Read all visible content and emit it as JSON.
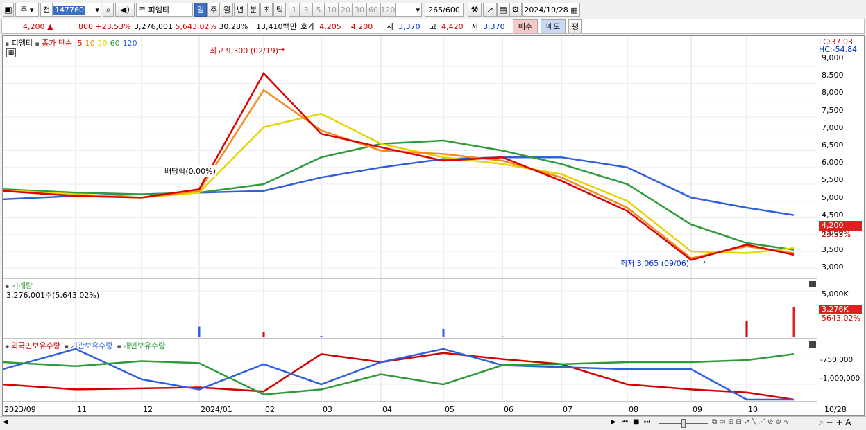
{
  "toolbar": {
    "market": "주",
    "scope": "전",
    "code": "147760",
    "prefix": "코",
    "name": "피엠티",
    "periods": [
      "일",
      "주",
      "월",
      "년",
      "분",
      "초",
      "틱"
    ],
    "active_period": "일",
    "intervals": [
      "1",
      "3",
      "5",
      "10",
      "20",
      "30",
      "60",
      "120"
    ],
    "count": "265",
    "count_total": "/600",
    "date": "2024/10/28"
  },
  "quote": {
    "price": "4,200",
    "change_arrow": "▲",
    "change": "800",
    "change_pct": "+23.53%",
    "volume": "3,276,001",
    "volume_pct": "5,643.02%",
    "turnover": "30.28%",
    "amount": "13,410백만",
    "ask_label": "호가",
    "ask": "4,205",
    "bid": "4,200",
    "open_label": "시",
    "open": "3,370",
    "high_label": "고",
    "high": "4,420",
    "low_label": "저",
    "low": "3,370",
    "buy_label": "매수",
    "sell_label": "매도",
    "eval_label": "평"
  },
  "price_panel": {
    "title": "피엠티",
    "ma_label": "종가 단순",
    "ma_periods": [
      {
        "label": "5",
        "color": "#e00000"
      },
      {
        "label": "10",
        "color": "#f28c1e"
      },
      {
        "label": "20",
        "color": "#e6d400"
      },
      {
        "label": "60",
        "color": "#2e9a3a"
      },
      {
        "label": "120",
        "color": "#2f5fdc"
      }
    ],
    "max_note": "최고 9,300 (02/19)",
    "min_note": "최저 3,065 (09/06)",
    "dividend_note": "배당락(0.00%)",
    "lc": "LC:37.03",
    "hc": "HC:-54.84",
    "price_tag": "4,200",
    "pct_tag": "23.53%",
    "y_ticks": [
      "9,000",
      "8,500",
      "8,000",
      "7,500",
      "7,000",
      "6,500",
      "6,000",
      "5,500",
      "5,000",
      "4,500",
      "4,000",
      "3,500",
      "3,000"
    ]
  },
  "volume_panel": {
    "title": "거래량",
    "subtitle": "3,276,001주(5,643.02%)",
    "y_tick": "5,000K",
    "tag": "3,276K",
    "pct_tag": "5643.02%"
  },
  "holding_panel": {
    "series": [
      {
        "name": "외국인보유수량",
        "color": "#d20000"
      },
      {
        "name": "기관보유수량",
        "color": "#2f5fdc"
      },
      {
        "name": "개인보유수량",
        "color": "#2e9a3a"
      }
    ],
    "y_ticks": [
      "-750,000",
      "-1,000,000"
    ]
  },
  "x_axis": [
    "2023/09",
    "11",
    "12",
    "2024/01",
    "02",
    "03",
    "04",
    "05",
    "06",
    "07",
    "08",
    "09",
    "10",
    "10/28"
  ],
  "chart_data": [
    {
      "type": "line",
      "title": "피엠티",
      "x": [
        "2023/09",
        "11",
        "12",
        "2024/01",
        "02",
        "03",
        "04",
        "05",
        "06",
        "07",
        "08",
        "09",
        "10",
        "10/28"
      ],
      "series": [
        {
          "name": "5",
          "values": [
            5300,
            5150,
            5100,
            5350,
            8800,
            7000,
            6600,
            6200,
            6300,
            5600,
            4700,
            3250,
            3700,
            3400
          ]
        },
        {
          "name": "10",
          "values": [
            5300,
            5150,
            5100,
            5300,
            8300,
            7100,
            6500,
            6400,
            6200,
            5700,
            4800,
            3300,
            3650,
            3450
          ]
        },
        {
          "name": "20",
          "values": [
            5320,
            5200,
            5100,
            5250,
            7200,
            7600,
            6700,
            6300,
            6100,
            5800,
            5000,
            3500,
            3450,
            3600
          ]
        },
        {
          "name": "60",
          "values": [
            5350,
            5250,
            5200,
            5250,
            5500,
            6300,
            6700,
            6800,
            6500,
            6100,
            5500,
            4300,
            3750,
            3550
          ]
        },
        {
          "name": "120",
          "values": [
            5050,
            5150,
            5200,
            5250,
            5300,
            5700,
            6000,
            6250,
            6300,
            6300,
            6000,
            5100,
            4800,
            4580
          ]
        }
      ],
      "ylim": [
        2800,
        9500
      ]
    },
    {
      "type": "bar",
      "title": "거래량",
      "categories": [
        "2023/09",
        "11",
        "12",
        "2024/01",
        "02",
        "03",
        "04",
        "05",
        "06",
        "07",
        "08",
        "09",
        "10",
        "10/28"
      ],
      "values": [
        60,
        50,
        40,
        1150,
        600,
        150,
        80,
        900,
        100,
        80,
        60,
        40,
        1800,
        3276
      ],
      "ylim": [
        0,
        5600
      ]
    },
    {
      "type": "line",
      "series": [
        {
          "name": "외국인보유수량",
          "values": [
            -1000000,
            -1050000,
            -1040000,
            -1030000,
            -1070000,
            -700000,
            -780000,
            -690000,
            -750000,
            -800000,
            -1000000,
            -1050000,
            -1080000,
            -1150000
          ]
        },
        {
          "name": "기관보유수량",
          "values": [
            -850000,
            -650000,
            -950000,
            -1050000,
            -800000,
            -1000000,
            -780000,
            -650000,
            -810000,
            -830000,
            -850000,
            -850000,
            -1150000,
            -1150000
          ]
        },
        {
          "name": "개인보유수량",
          "values": [
            -780000,
            -820000,
            -770000,
            -790000,
            -1100000,
            -1050000,
            -900000,
            -1000000,
            -810000,
            -800000,
            -780000,
            -780000,
            -760000,
            -700000
          ]
        }
      ],
      "yticks": [
        -750000,
        -1000000
      ]
    }
  ]
}
